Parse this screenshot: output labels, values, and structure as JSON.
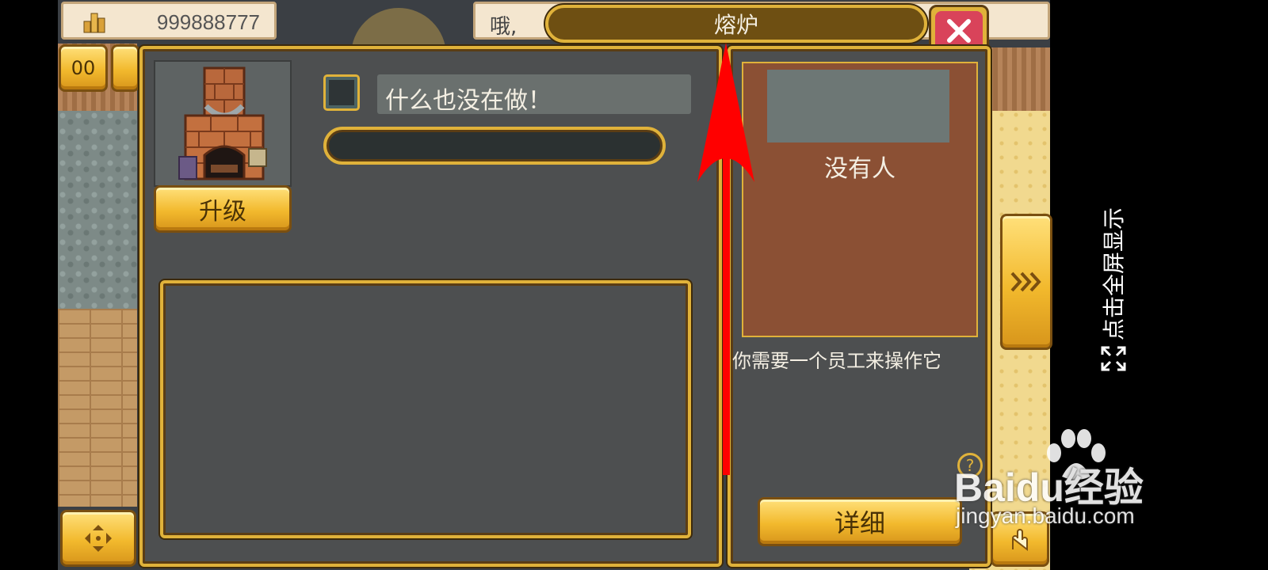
{
  "hud": {
    "money": "999888777",
    "message_prefix": "哦,",
    "left_button_label": "00"
  },
  "dialog": {
    "title": "熔炉",
    "status_text": "什么也没在做！",
    "upgrade_label": "升级",
    "worker_name": "没有人",
    "worker_hint": "你需要一个员工来操作它",
    "detail_label": "详细",
    "help_glyph": "?"
  },
  "sidebar": {
    "fullscreen_label": "点击全屏显示"
  },
  "watermark": {
    "brand": "Baidu经验",
    "url": "jingyan.baidu.com"
  },
  "colors": {
    "panel_bg": "#4d4f50",
    "gold": "#e0b23a",
    "worker_card": "#8b5034",
    "arrow": "#ff0000"
  }
}
